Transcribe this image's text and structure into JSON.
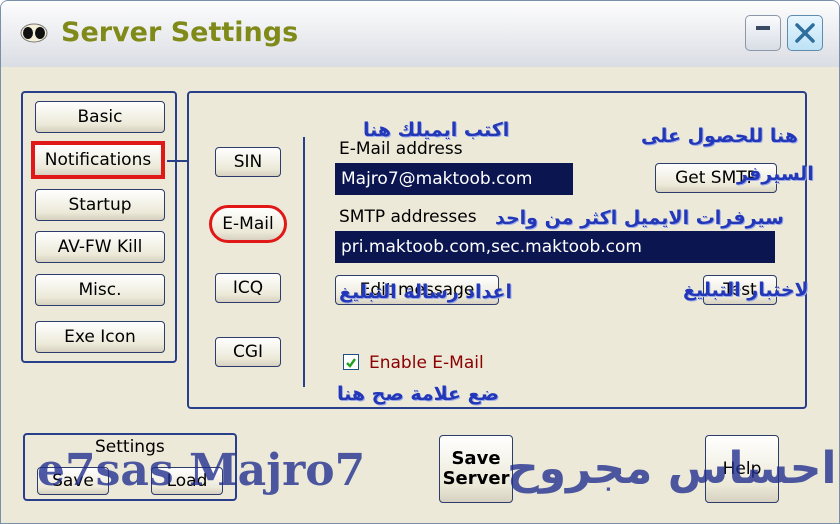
{
  "window": {
    "title": "Server Settings",
    "icon": "alien-icon",
    "minimize_icon": "minimize-icon",
    "close_icon": "close-icon"
  },
  "sidebar": {
    "items": [
      {
        "label": "Basic"
      },
      {
        "label": "Notifications",
        "selected": true
      },
      {
        "label": "Startup"
      },
      {
        "label": "AV-FW Kill"
      },
      {
        "label": "Misc."
      },
      {
        "label": "Exe Icon"
      }
    ]
  },
  "notify_tabs": {
    "items": [
      {
        "label": "SIN"
      },
      {
        "label": "E-Mail",
        "selected": true
      },
      {
        "label": "ICQ"
      },
      {
        "label": "CGI"
      }
    ]
  },
  "email": {
    "address_label": "E-Mail address",
    "address_value": "Majro7@maktoob.com",
    "get_smtp_label": "Get SMTP",
    "smtp_label": "SMTP addresses",
    "smtp_value": "pri.maktoob.com,sec.maktoob.com",
    "edit_message_label": "Edit message",
    "test_label": "Test",
    "enable_label": "Enable E-Mail",
    "enable_checked": true
  },
  "settings_group": {
    "title": "Settings",
    "save_label": "Save",
    "load_label": "Load"
  },
  "footer": {
    "save_server_label": "Save Server",
    "help_label": "Help"
  },
  "annotations": {
    "write_email": "اكتب ايميلك هنا",
    "get_server_1": "هنا للحصول على",
    "get_server_2": "السيرفر",
    "smtp_servers": "سيرفرات الايميل اكثر من واحد",
    "setup_message": "اعداد رسالة التبليغ",
    "test_notify": "لاختبار التبليغ",
    "put_check": "ضع علامة صح هنا"
  },
  "watermark": {
    "latin": "e7sas Majro7",
    "arabic": "احساس مجروح"
  },
  "colors": {
    "title_text": "#7f8a18",
    "group_border": "#2a3f8a",
    "field_bg": "#0b1550",
    "highlight_red": "#e01818",
    "annotation_blue": "#2238b8",
    "enable_label": "#8b0000"
  }
}
